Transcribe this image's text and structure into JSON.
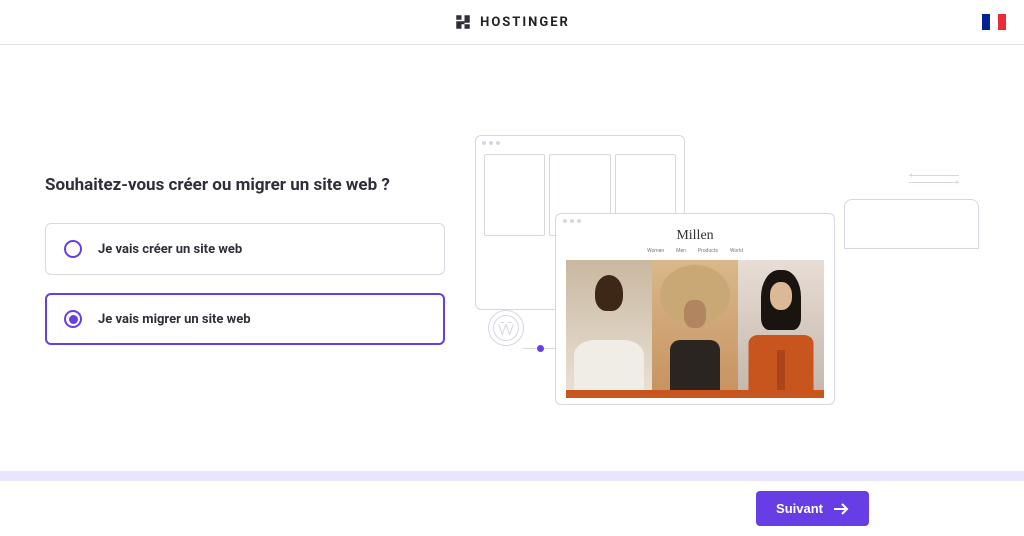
{
  "header": {
    "brand": "HOSTINGER",
    "locale": "fr"
  },
  "question": "Souhaitez-vous créer ou migrer un site web ?",
  "options": [
    {
      "label": "Je vais créer un site web",
      "selected": false
    },
    {
      "label": "Je vais migrer un site web",
      "selected": true
    }
  ],
  "preview": {
    "title": "Millen",
    "nav": [
      "Women",
      "Men",
      "Products",
      "World"
    ]
  },
  "footer": {
    "next_label": "Suivant"
  },
  "colors": {
    "accent": "#673de6"
  }
}
